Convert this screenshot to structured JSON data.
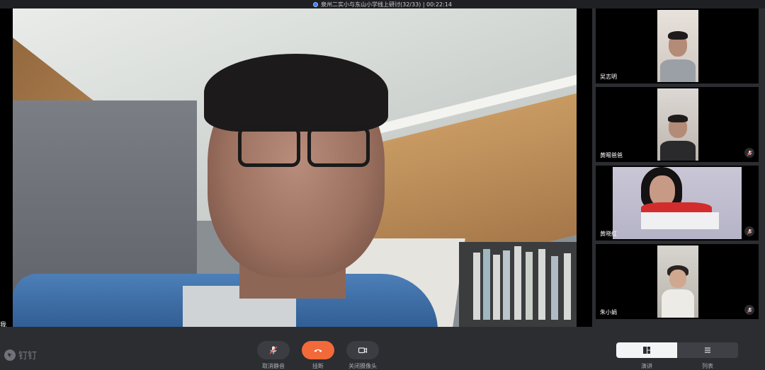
{
  "window": {
    "title": "泉州二实小与东山小学线上研讨(32/33) | 00:22:14"
  },
  "main_video": {
    "self_label": "我"
  },
  "participants": [
    {
      "name": "吴志明",
      "mic": "none"
    },
    {
      "name": "黄晹爸爸",
      "mic": "muted"
    },
    {
      "name": "黄晓红",
      "mic": "muted"
    },
    {
      "name": "朱小娟",
      "mic": "muted"
    }
  ],
  "controls": {
    "unmute_label": "取消静音",
    "hangup_label": "挂断",
    "camera_label": "关闭摄像头",
    "speaker_view_label": "演讲",
    "list_view_label": "列表"
  },
  "brand": {
    "logo_text": "钉钉"
  },
  "colors": {
    "hangup": "#f2693a",
    "accent": "#3a7bff"
  }
}
